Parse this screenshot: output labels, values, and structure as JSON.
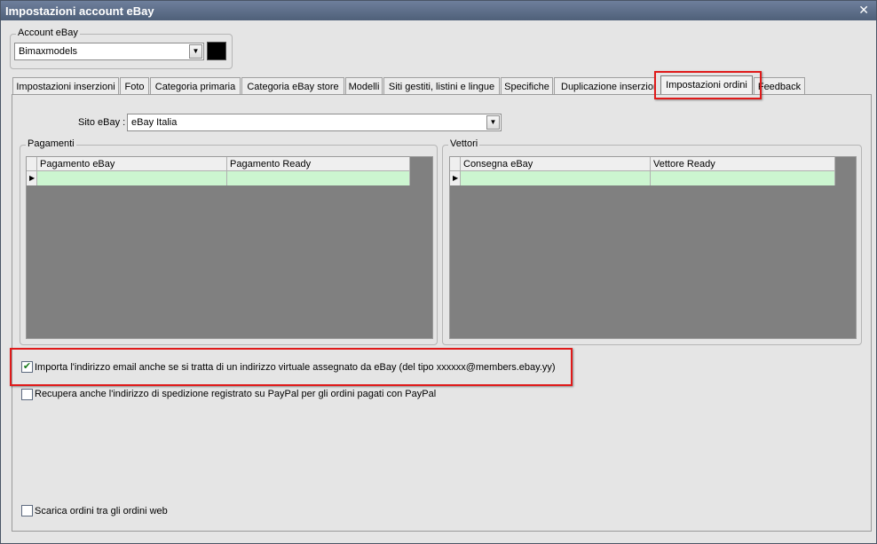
{
  "window": {
    "title": "Impostazioni account eBay"
  },
  "account": {
    "group_label": "Account eBay",
    "selected": "Bimaxmodels",
    "swatch_color": "#000000"
  },
  "tabs": [
    {
      "label": "Impostazioni inserzioni"
    },
    {
      "label": "Foto"
    },
    {
      "label": "Categoria primaria"
    },
    {
      "label": "Categoria eBay store"
    },
    {
      "label": "Modelli"
    },
    {
      "label": "Siti gestiti, listini e lingue"
    },
    {
      "label": "Specifiche"
    },
    {
      "label": "Duplicazione inserzioni"
    },
    {
      "label": "Impostazioni ordini",
      "active": true
    },
    {
      "label": "Feedback"
    }
  ],
  "site": {
    "label": "Sito eBay :",
    "selected": "eBay Italia"
  },
  "payments": {
    "group_label": "Pagamenti",
    "columns": [
      "Pagamento eBay",
      "Pagamento Ready"
    ]
  },
  "carriers": {
    "group_label": "Vettori",
    "columns": [
      "Consegna eBay",
      "Vettore Ready"
    ]
  },
  "options": {
    "import_email": {
      "label": "Importa l'indirizzo email anche se si tratta di un indirizzo virtuale assegnato da eBay (del tipo xxxxxx@members.ebay.yy)",
      "checked": true
    },
    "paypal_address": {
      "label": "Recupera anche l'indirizzo di spedizione registrato su PayPal per gli ordini pagati con PayPal",
      "checked": false
    },
    "web_orders": {
      "label": "Scarica ordini tra gli ordini web",
      "checked": false
    }
  },
  "colors": {
    "highlight": "#e01a1a",
    "new_row": "#ccf5d0",
    "grid_bg": "#808080"
  }
}
